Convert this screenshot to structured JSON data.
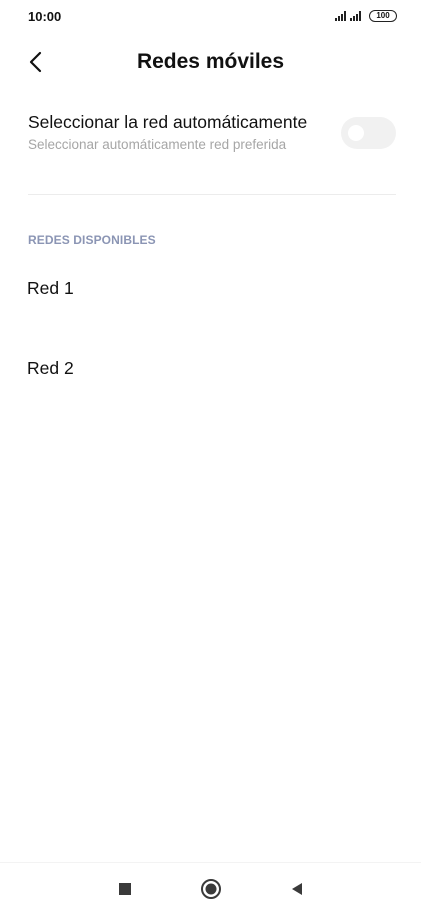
{
  "status_bar": {
    "time": "10:00",
    "battery": "100",
    "icons": [
      "signal-icon",
      "signal-icon",
      "battery-icon"
    ]
  },
  "header": {
    "title": "Redes móviles",
    "back_icon": "chevron-left-icon"
  },
  "auto_select": {
    "title": "Seleccionar la red automáticamente",
    "subtitle": "Seleccionar automáticamente red preferida",
    "enabled": false
  },
  "available_networks": {
    "header": "REDES DISPONIBLES",
    "items": [
      {
        "label": "Red 1"
      },
      {
        "label": "Red 2"
      }
    ]
  },
  "nav_bar": {
    "icons": [
      "recents-square-icon",
      "home-circle-icon",
      "back-triangle-icon"
    ]
  },
  "colors": {
    "section_header": "#8b95b4",
    "subtitle": "#a6a6a6",
    "toggle_off": "#f1f1f1"
  }
}
